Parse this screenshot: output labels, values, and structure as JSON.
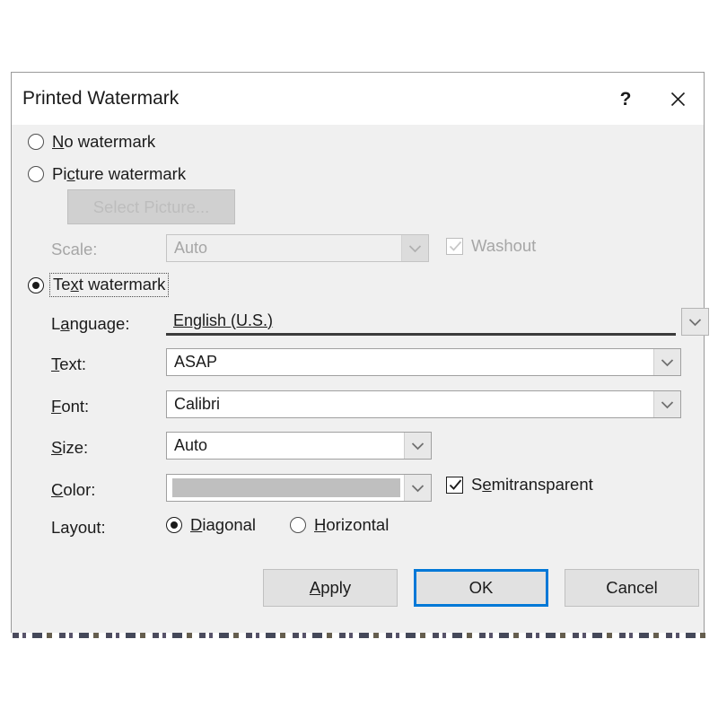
{
  "dialog": {
    "title": "Printed Watermark",
    "help_icon": "question-mark-icon",
    "close_icon": "close-icon"
  },
  "options": {
    "no_watermark": {
      "label_prefix": "",
      "accel": "N",
      "label_rest": "o watermark",
      "selected": false
    },
    "picture_watermark": {
      "label_prefix": "Pi",
      "accel": "c",
      "label_rest": "ture watermark",
      "selected": false
    },
    "text_watermark": {
      "label_prefix": "Te",
      "accel": "x",
      "label_rest": "t watermark",
      "selected": true
    }
  },
  "picture_section": {
    "select_picture_button": "Select Picture...",
    "scale_label": "Scale:",
    "scale_value": "Auto",
    "washout_label": "Washout",
    "washout_checked": true,
    "enabled": false
  },
  "text_section": {
    "language_label_prefix": "L",
    "language_accel": "a",
    "language_label_rest": "nguage:",
    "language_value": "English (U.S.)",
    "text_label_prefix": "",
    "text_accel": "T",
    "text_label_rest": "ext:",
    "text_value": "ASAP",
    "font_label_prefix": "",
    "font_accel": "F",
    "font_label_rest": "ont:",
    "font_value": "Calibri",
    "size_label_prefix": "",
    "size_accel": "S",
    "size_label_rest": "ize:",
    "size_value": "Auto",
    "color_label_prefix": "",
    "color_accel": "C",
    "color_label_rest": "olor:",
    "color_value_hex": "#BFBFBF",
    "semitransparent_label_prefix": "S",
    "semitransparent_accel": "e",
    "semitransparent_label_rest": "mitransparent",
    "semitransparent_checked": true,
    "layout_label": "Layout:",
    "layout_diagonal_prefix": "",
    "layout_diagonal_accel": "D",
    "layout_diagonal_rest": "iagonal",
    "layout_horizontal_prefix": "",
    "layout_horizontal_accel": "H",
    "layout_horizontal_rest": "orizontal",
    "layout_selected": "Diagonal"
  },
  "footer": {
    "apply_prefix": "",
    "apply_accel": "A",
    "apply_rest": "pply",
    "ok_label": "OK",
    "cancel_label": "Cancel",
    "default_button": "OK"
  },
  "colors": {
    "accent": "#0078D7",
    "dialog_bg": "#F0F0F0",
    "titlebar_bg": "#FFFFFF",
    "disabled_text": "#A6A6A6"
  }
}
